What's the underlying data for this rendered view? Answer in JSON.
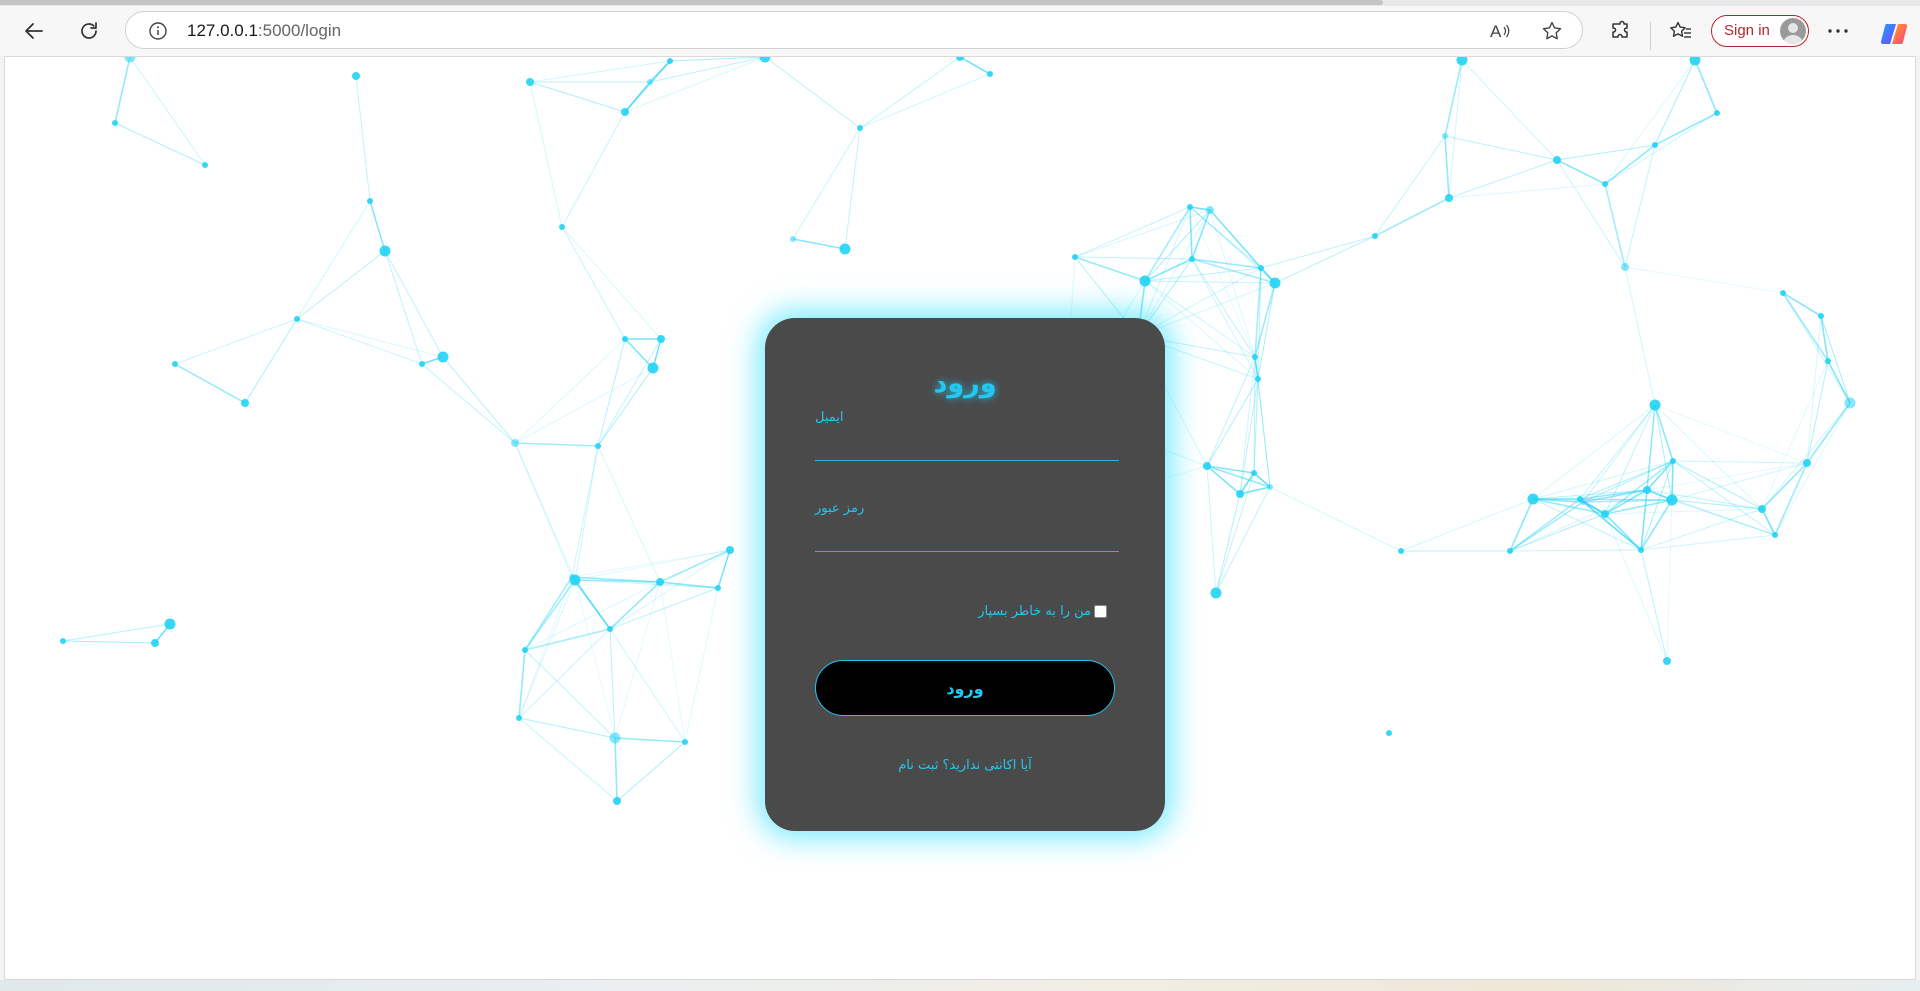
{
  "browser": {
    "url_host": "127.0.0.1",
    "url_path": ":5000/login",
    "sign_in_label": "Sign in",
    "icons": [
      "back-icon",
      "refresh-icon",
      "info-icon",
      "read-aloud-icon",
      "favorite-star-icon",
      "extensions-icon",
      "favorites-icon",
      "more-icon",
      "copilot-icon"
    ]
  },
  "login": {
    "title": "ورود",
    "email_label": "ایمیل",
    "email_value": "",
    "password_label": "رمز عبور",
    "password_value": "",
    "remember_label": "من را به خاطر بسپار",
    "remember_checked": false,
    "submit_label": "ورود",
    "register_prompt": "آیا اکانتی ندارید؟",
    "register_link": "ثبت نام"
  },
  "colors": {
    "accent": "#23c8f0",
    "card_bg": "#4a4a4a",
    "button_bg": "#000000",
    "node": "#22d3f5"
  }
}
